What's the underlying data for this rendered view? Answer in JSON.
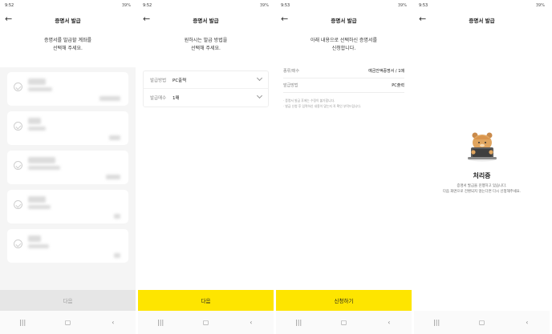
{
  "status_bar": [
    {
      "time": "9:52",
      "right": "39%"
    },
    {
      "time": "9:52",
      "right": "39%"
    },
    {
      "time": "9:53",
      "right": "39%"
    },
    {
      "time": "9:53",
      "right": "39%"
    }
  ],
  "header": {
    "title": "증명서 발급",
    "back": "←"
  },
  "screen1": {
    "heading_line1": "증명서를 발급할 계좌를",
    "heading_line2": "선택해 주세요.",
    "button": "다음"
  },
  "screen2": {
    "heading_line1": "원하시는 발급 방법을",
    "heading_line2": "선택해 주세요.",
    "fields": [
      {
        "label": "발급방법",
        "value": "PC출력"
      },
      {
        "label": "발급매수",
        "value": "1매"
      }
    ],
    "button": "다음"
  },
  "screen3": {
    "heading_line1": "아래 내용으로 선택하신 증명서를",
    "heading_line2": "신청합니다.",
    "rows": [
      {
        "label": "종류/매수",
        "value": "예금잔액증명서 / 1매"
      },
      {
        "label": "발급방법",
        "value": "PC출력"
      }
    ],
    "note_line1": "· 증명서 발급 후에는 수정이 불가합니다.",
    "note_line2": "· 발급 신청 후 입력하신 내용이 맞는지 꼭 확인 부탁드립니다.",
    "button": "신청하기"
  },
  "screen4": {
    "title": "처리중",
    "desc_line1": "증명서 발급을 진행하고 있습니다.",
    "desc_line2": "다음 화면으로 전환되지 않는다면 다시 신청해주세요."
  },
  "nav": {
    "recent": "|||",
    "home": "▢",
    "back": "‹"
  },
  "colors": {
    "accent": "#fee500",
    "disabled": "#e6e6e6",
    "list_bg": "#f5f5f5"
  }
}
